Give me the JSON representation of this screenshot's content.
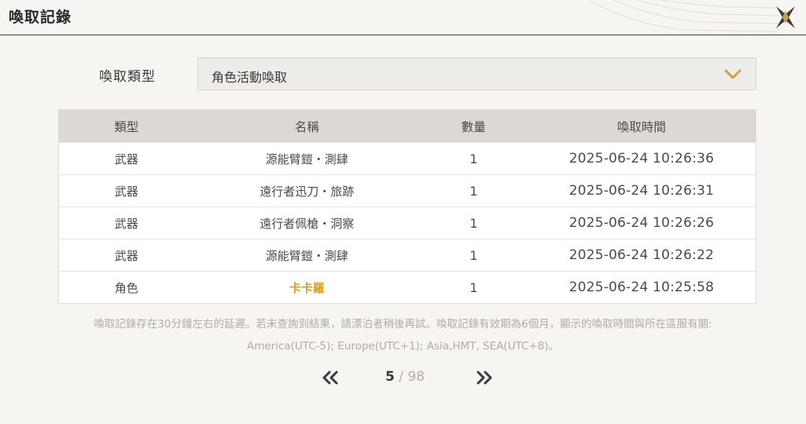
{
  "header": {
    "title": "喚取記錄"
  },
  "filter": {
    "label": "喚取類型",
    "selected": "角色活動喚取"
  },
  "table": {
    "columns": [
      "類型",
      "名稱",
      "數量",
      "喚取時間"
    ],
    "rows": [
      {
        "type": "武器",
        "name": "源能臂鎧・測肆",
        "qty": "1",
        "time": "2025-06-24 10:26:36",
        "highlight": false
      },
      {
        "type": "武器",
        "name": "遠行者迅刀・旅跡",
        "qty": "1",
        "time": "2025-06-24 10:26:31",
        "highlight": false
      },
      {
        "type": "武器",
        "name": "遠行者佩槍・洞察",
        "qty": "1",
        "time": "2025-06-24 10:26:26",
        "highlight": false
      },
      {
        "type": "武器",
        "name": "源能臂鎧・測肆",
        "qty": "1",
        "time": "2025-06-24 10:26:22",
        "highlight": false
      },
      {
        "type": "角色",
        "name": "卡卡羅",
        "qty": "1",
        "time": "2025-06-24 10:25:58",
        "highlight": true
      }
    ]
  },
  "note": {
    "line1": "喚取記錄存在30分鐘左右的延遲。若未查詢到結果，請漂泊者稍後再試。喚取記錄有效期為6個月，顯示的喚取時間與所在區服有關:",
    "line2": "America(UTC-5); Europe(UTC+1); Asia,HMT, SEA(UTC+8)。"
  },
  "pager": {
    "current": "5",
    "separator": "/",
    "total": "98"
  },
  "colors": {
    "accent": "#c8a24a",
    "highlight": "#d6a21e",
    "header_bg": "#dcd9d5"
  },
  "icons": {
    "close": "close-x-icon",
    "dropdown": "chevron-down-icon",
    "prev": "double-chevron-left-icon",
    "next": "double-chevron-right-icon"
  }
}
